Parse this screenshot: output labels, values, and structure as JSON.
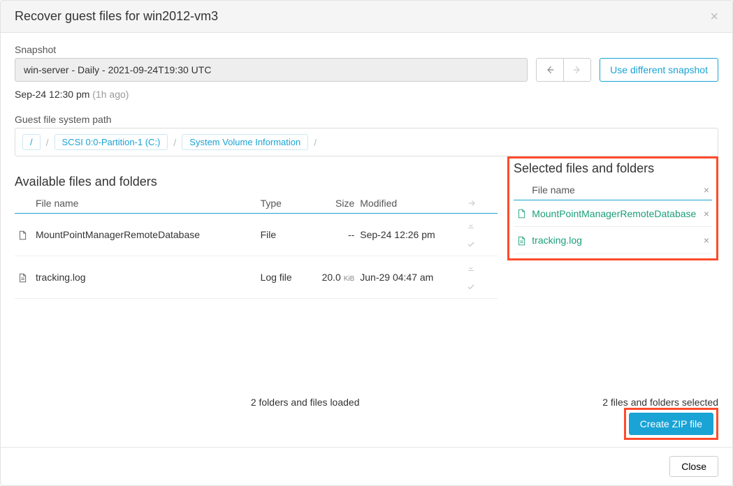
{
  "header": {
    "title": "Recover guest files for win2012-vm3"
  },
  "snapshot": {
    "label": "Snapshot",
    "value": "win-server - Daily - 2021-09-24T19:30 UTC",
    "use_different": "Use different snapshot"
  },
  "timestamp": {
    "text": "Sep-24 12:30 pm",
    "ago": "(1h ago)"
  },
  "path": {
    "label": "Guest file system path",
    "crumbs": [
      "/",
      "SCSI 0:0-Partition-1 (C:)",
      "System Volume Information"
    ]
  },
  "available": {
    "title": "Available files and folders",
    "columns": {
      "name": "File name",
      "type": "Type",
      "size": "Size",
      "modified": "Modified"
    },
    "rows": [
      {
        "name": "MountPointManagerRemoteDatabase",
        "type": "File",
        "size": "--",
        "unit": "",
        "modified": "Sep-24 12:26 pm"
      },
      {
        "name": "tracking.log",
        "type": "Log file",
        "size": "20.0",
        "unit": "KiB",
        "modified": "Jun-29 04:47 am"
      }
    ]
  },
  "selected": {
    "title": "Selected files and folders",
    "columns": {
      "name": "File name"
    },
    "rows": [
      {
        "name": "MountPointManagerRemoteDatabase"
      },
      {
        "name": "tracking.log"
      }
    ]
  },
  "counts": {
    "loaded": "2 folders and files loaded",
    "selected": "2 files and folders selected"
  },
  "actions": {
    "create_zip": "Create ZIP file",
    "close": "Close"
  }
}
